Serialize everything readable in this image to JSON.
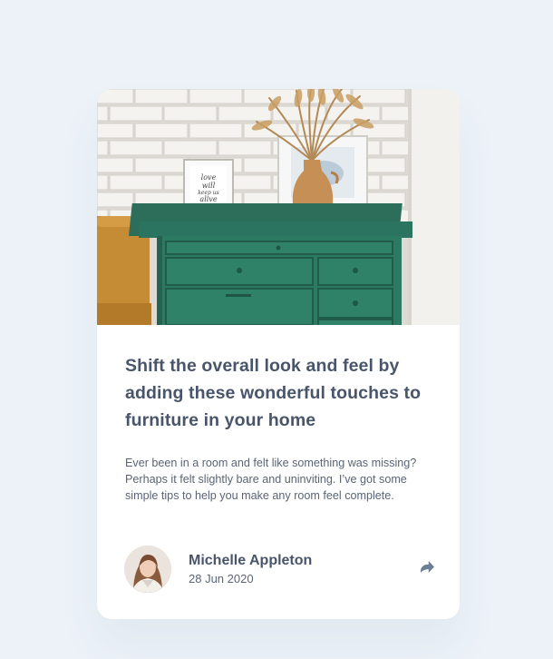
{
  "article": {
    "title": "Shift the overall look and feel by adding these wonderful touches to furniture in your home",
    "excerpt": "Ever been in a room and felt like something was missing? Perhaps it felt slightly bare and uninviting. I’ve got some simple tips to help you make any room feel complete."
  },
  "author": {
    "name": "Michelle Appleton",
    "date": "28 Jun 2020"
  },
  "hero": {
    "frame_text": "love will keep us alive"
  },
  "icons": {
    "share": "share-icon"
  },
  "colors": {
    "background": "#ecf2f8",
    "card": "#ffffff",
    "heading": "#48556a",
    "body_text": "#5a6476",
    "icon": "#6d7f97",
    "drawer_green": "#2d7a63"
  }
}
